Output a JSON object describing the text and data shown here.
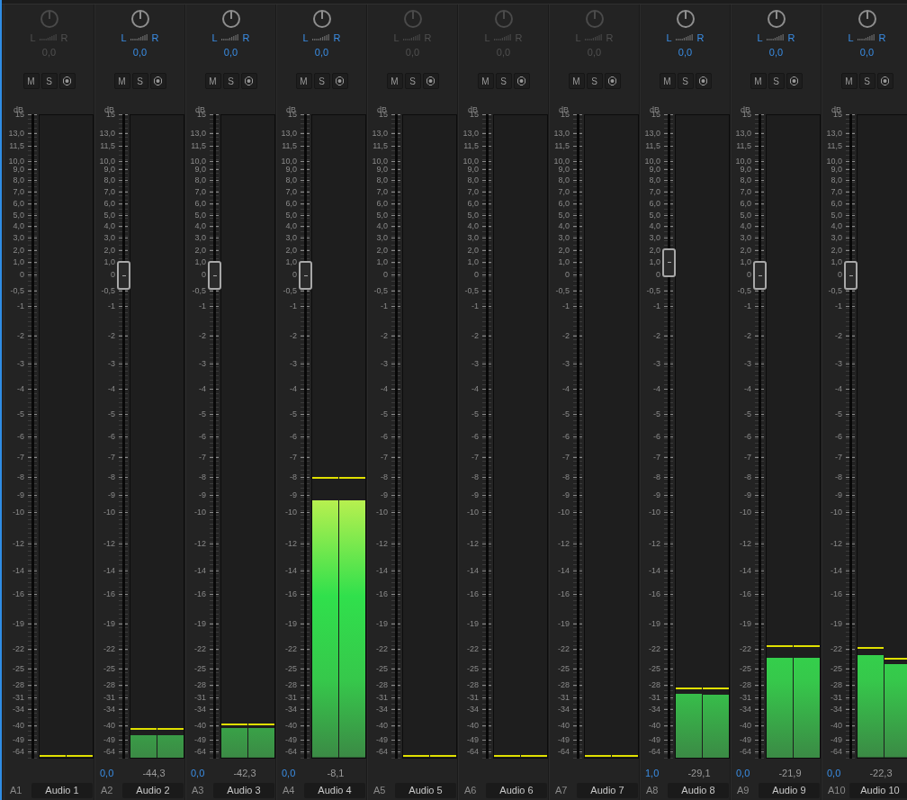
{
  "channels": [
    {
      "id": "A1",
      "name": "Audio 1",
      "enabled": false,
      "pan": {
        "left": "L",
        "right": "R",
        "value": "0,0"
      },
      "mute": "M",
      "solo": "S",
      "scale_unit": "dB",
      "scale": [
        "15",
        "13,0",
        "11,5",
        "10,0",
        "9,0",
        "8,0",
        "7,0",
        "6,0",
        "5,0",
        "4,0",
        "3,0",
        "2,0",
        "1,0",
        "0",
        "-0,5",
        "-1",
        "-2",
        "-3",
        "-4",
        "-5",
        "-6",
        "-7",
        "-8",
        "-9",
        "-10",
        "-12",
        "-14",
        "-16",
        "-19",
        "-22",
        "-25",
        "-28",
        "-31",
        "-34",
        "-40",
        "-49",
        "-64"
      ],
      "bars": [
        {
          "level": 0,
          "peak_hold": {
            "level": 0.002
          }
        },
        {
          "level": 0,
          "peak_hold": {
            "level": 0.002
          }
        }
      ]
    },
    {
      "id": "A2",
      "name": "Audio 2",
      "enabled": true,
      "pan": {
        "left": "L",
        "right": "R",
        "value": "0,0"
      },
      "mute": "M",
      "solo": "S",
      "scale_unit": "dB",
      "scale": [
        "15",
        "13,0",
        "11,5",
        "10,0",
        "9,0",
        "8,0",
        "7,0",
        "6,0",
        "5,0",
        "4,0",
        "3,0",
        "2,0",
        "1,0",
        "0",
        "-0,5",
        "-1",
        "-2",
        "-3",
        "-4",
        "-5",
        "-6",
        "-7",
        "-8",
        "-9",
        "-10",
        "-12",
        "-14",
        "-16",
        "-19",
        "-22",
        "-25",
        "-28",
        "-31",
        "-34",
        "-40",
        "-49",
        "-64"
      ],
      "bars": [
        {
          "level": 0.035,
          "peak_hold": {
            "level": 0.043
          }
        },
        {
          "level": 0.035,
          "peak_hold": {
            "level": 0.043
          }
        }
      ],
      "fader": {
        "level": 0.751,
        "reading": "0,0"
      },
      "meter_reading": "-44,3"
    },
    {
      "id": "A3",
      "name": "Audio 3",
      "enabled": true,
      "pan": {
        "left": "L",
        "right": "R",
        "value": "0,0"
      },
      "mute": "M",
      "solo": "S",
      "scale_unit": "dB",
      "scale": [
        "15",
        "13,0",
        "11,5",
        "10,0",
        "9,0",
        "8,0",
        "7,0",
        "6,0",
        "5,0",
        "4,0",
        "3,0",
        "2,0",
        "1,0",
        "0",
        "-0,5",
        "-1",
        "-2",
        "-3",
        "-4",
        "-5",
        "-6",
        "-7",
        "-8",
        "-9",
        "-10",
        "-12",
        "-14",
        "-16",
        "-19",
        "-22",
        "-25",
        "-28",
        "-31",
        "-34",
        "-40",
        "-49",
        "-64"
      ],
      "bars": [
        {
          "level": 0.046,
          "peak_hold": {
            "level": 0.05
          }
        },
        {
          "level": 0.046,
          "peak_hold": {
            "level": 0.05
          }
        }
      ],
      "fader": {
        "level": 0.751,
        "reading": "0,0"
      },
      "meter_reading": "-42,3"
    },
    {
      "id": "A4",
      "name": "Audio 4",
      "enabled": true,
      "pan": {
        "left": "L",
        "right": "R",
        "value": "0,0"
      },
      "mute": "M",
      "solo": "S",
      "scale_unit": "dB",
      "scale": [
        "15",
        "13,0",
        "11,5",
        "10,0",
        "9,0",
        "8,0",
        "7,0",
        "6,0",
        "5,0",
        "4,0",
        "3,0",
        "2,0",
        "1,0",
        "0",
        "-0,5",
        "-1",
        "-2",
        "-3",
        "-4",
        "-5",
        "-6",
        "-7",
        "-8",
        "-9",
        "-10",
        "-12",
        "-14",
        "-16",
        "-19",
        "-22",
        "-25",
        "-28",
        "-31",
        "-34",
        "-40",
        "-49",
        "-64"
      ],
      "bars": [
        {
          "level": 0.4,
          "peak_hold": {
            "level": 0.434
          }
        },
        {
          "level": 0.4,
          "peak_hold": {
            "level": 0.434
          }
        }
      ],
      "fader": {
        "level": 0.751,
        "reading": "0,0"
      },
      "meter_reading": "-8,1"
    },
    {
      "id": "A5",
      "name": "Audio 5",
      "enabled": false,
      "pan": {
        "left": "L",
        "right": "R",
        "value": "0,0"
      },
      "mute": "M",
      "solo": "S",
      "scale_unit": "dB",
      "scale": [
        "15",
        "13,0",
        "11,5",
        "10,0",
        "9,0",
        "8,0",
        "7,0",
        "6,0",
        "5,0",
        "4,0",
        "3,0",
        "2,0",
        "1,0",
        "0",
        "-0,5",
        "-1",
        "-2",
        "-3",
        "-4",
        "-5",
        "-6",
        "-7",
        "-8",
        "-9",
        "-10",
        "-12",
        "-14",
        "-16",
        "-19",
        "-22",
        "-25",
        "-28",
        "-31",
        "-34",
        "-40",
        "-49",
        "-64"
      ],
      "bars": [
        {
          "level": 0,
          "peak_hold": {
            "level": 0.002
          }
        },
        {
          "level": 0,
          "peak_hold": {
            "level": 0.002
          }
        }
      ]
    },
    {
      "id": "A6",
      "name": "Audio 6",
      "enabled": false,
      "pan": {
        "left": "L",
        "right": "R",
        "value": "0,0"
      },
      "mute": "M",
      "solo": "S",
      "scale_unit": "dB",
      "scale": [
        "15",
        "13,0",
        "11,5",
        "10,0",
        "9,0",
        "8,0",
        "7,0",
        "6,0",
        "5,0",
        "4,0",
        "3,0",
        "2,0",
        "1,0",
        "0",
        "-0,5",
        "-1",
        "-2",
        "-3",
        "-4",
        "-5",
        "-6",
        "-7",
        "-8",
        "-9",
        "-10",
        "-12",
        "-14",
        "-16",
        "-19",
        "-22",
        "-25",
        "-28",
        "-31",
        "-34",
        "-40",
        "-49",
        "-64"
      ],
      "bars": [
        {
          "level": 0,
          "peak_hold": {
            "level": 0.002
          }
        },
        {
          "level": 0,
          "peak_hold": {
            "level": 0.002
          }
        }
      ]
    },
    {
      "id": "A7",
      "name": "Audio 7",
      "enabled": false,
      "pan": {
        "left": "L",
        "right": "R",
        "value": "0,0"
      },
      "mute": "M",
      "solo": "S",
      "scale_unit": "dB",
      "scale": [
        "15",
        "13,0",
        "11,5",
        "10,0",
        "9,0",
        "8,0",
        "7,0",
        "6,0",
        "5,0",
        "4,0",
        "3,0",
        "2,0",
        "1,0",
        "0",
        "-0,5",
        "-1",
        "-2",
        "-3",
        "-4",
        "-5",
        "-6",
        "-7",
        "-8",
        "-9",
        "-10",
        "-12",
        "-14",
        "-16",
        "-19",
        "-22",
        "-25",
        "-28",
        "-31",
        "-34",
        "-40",
        "-49",
        "-64"
      ],
      "bars": [
        {
          "level": 0,
          "peak_hold": {
            "level": 0.002
          }
        },
        {
          "level": 0,
          "peak_hold": {
            "level": 0.002
          }
        }
      ]
    },
    {
      "id": "A8",
      "name": "Audio 8",
      "enabled": true,
      "pan": {
        "left": "L",
        "right": "R",
        "value": "0,0"
      },
      "mute": "M",
      "solo": "S",
      "scale_unit": "dB",
      "scale": [
        "15",
        "13,0",
        "11,5",
        "10,0",
        "9,0",
        "8,0",
        "7,0",
        "6,0",
        "5,0",
        "4,0",
        "3,0",
        "2,0",
        "1,0",
        "0",
        "-0,5",
        "-1",
        "-2",
        "-3",
        "-4",
        "-5",
        "-6",
        "-7",
        "-8",
        "-9",
        "-10",
        "-12",
        "-14",
        "-16",
        "-19",
        "-22",
        "-25",
        "-28",
        "-31",
        "-34",
        "-40",
        "-49",
        "-64"
      ],
      "bars": [
        {
          "level": 0.1,
          "peak_hold": {
            "level": 0.106
          }
        },
        {
          "level": 0.098,
          "peak_hold": {
            "level": 0.106
          }
        }
      ],
      "fader": {
        "level": 0.771,
        "reading": "1,0"
      },
      "meter_reading": "-29,1"
    },
    {
      "id": "A9",
      "name": "Audio 9",
      "enabled": true,
      "pan": {
        "left": "L",
        "right": "R",
        "value": "0,0"
      },
      "mute": "M",
      "solo": "S",
      "scale_unit": "dB",
      "scale": [
        "15",
        "13,0",
        "11,5",
        "10,0",
        "9,0",
        "8,0",
        "7,0",
        "6,0",
        "5,0",
        "4,0",
        "3,0",
        "2,0",
        "1,0",
        "0",
        "-0,5",
        "-1",
        "-2",
        "-3",
        "-4",
        "-5",
        "-6",
        "-7",
        "-8",
        "-9",
        "-10",
        "-12",
        "-14",
        "-16",
        "-19",
        "-22",
        "-25",
        "-28",
        "-31",
        "-34",
        "-40",
        "-49",
        "-64"
      ],
      "bars": [
        {
          "level": 0.156,
          "peak_hold": {
            "level": 0.172
          }
        },
        {
          "level": 0.156,
          "peak_hold": {
            "level": 0.172
          }
        }
      ],
      "fader": {
        "level": 0.751,
        "reading": "0,0"
      },
      "meter_reading": "-21,9"
    },
    {
      "id": "A10",
      "name": "Audio 10",
      "enabled": true,
      "pan": {
        "left": "L",
        "right": "R",
        "value": "0,0"
      },
      "mute": "M",
      "solo": "S",
      "scale_unit": "dB",
      "scale": [
        "15",
        "13,0",
        "11,5",
        "10,0",
        "9,0",
        "8,0",
        "7,0",
        "6,0",
        "5,0",
        "4,0",
        "3,0",
        "2,0",
        "1,0",
        "0",
        "-0,5",
        "-1",
        "-2",
        "-3",
        "-4",
        "-5",
        "-6",
        "-7",
        "-8",
        "-9",
        "-10",
        "-12",
        "-14",
        "-16",
        "-19",
        "-22",
        "-25",
        "-28",
        "-31",
        "-34",
        "-40",
        "-49",
        "-64"
      ],
      "bars": [
        {
          "level": 0.159,
          "peak_hold": {
            "level": 0.169
          }
        },
        {
          "level": 0.145,
          "peak_hold": {
            "level": 0.152
          }
        }
      ],
      "fader": {
        "level": 0.751,
        "reading": "0,0"
      },
      "meter_reading": "-22,3"
    }
  ]
}
